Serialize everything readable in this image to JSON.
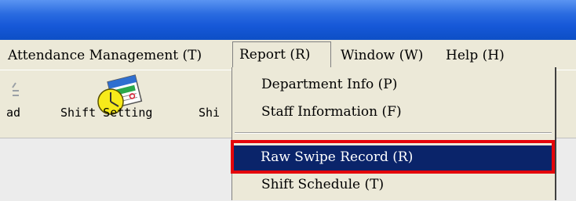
{
  "menubar": {
    "items": [
      {
        "label": "Attendance Management (T)"
      },
      {
        "label": "Report (R)"
      },
      {
        "label": "Window (W)"
      },
      {
        "label": "Help (H)"
      }
    ]
  },
  "toolbar": {
    "partial_left_label": "ad",
    "shift_setting_label": "Shift Setting",
    "partial_right_label": "Shi"
  },
  "report_menu": {
    "items": [
      {
        "label": "Department Info (P)"
      },
      {
        "label": "Staff Information (F)"
      },
      {
        "label": "Raw Swipe Record (R)"
      },
      {
        "label": "Shift Schedule (T)"
      }
    ],
    "highlighted_color": "#0a246a",
    "callout_color": "#e4050b"
  },
  "colors": {
    "titlebar": "#1658d8",
    "background": "#ece9d8"
  }
}
